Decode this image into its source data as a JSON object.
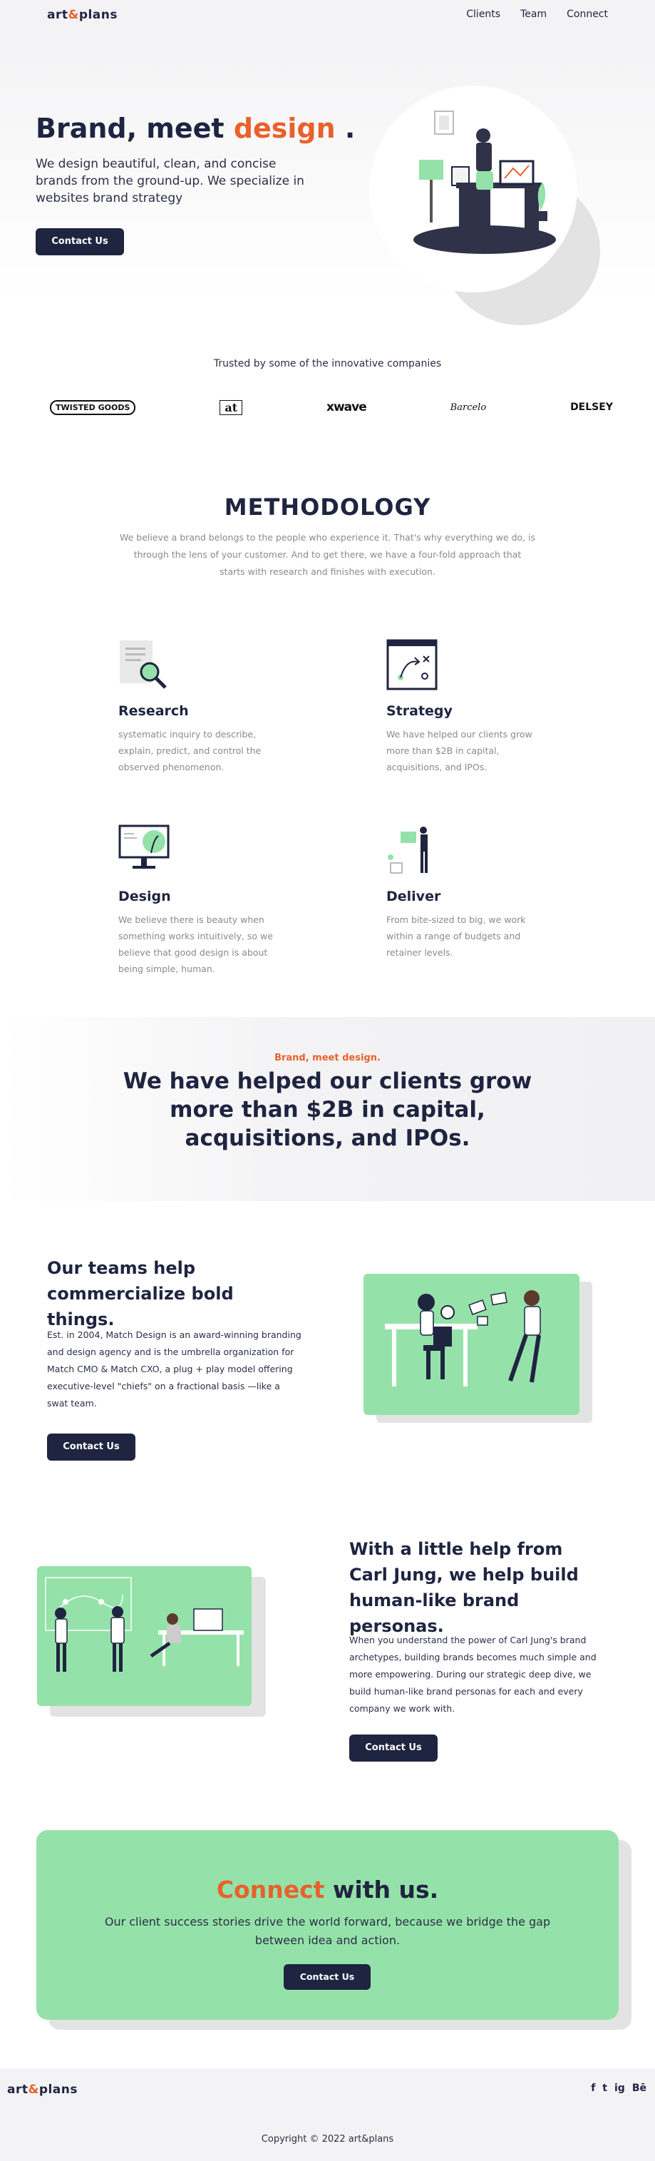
{
  "nav": {
    "logo_pre": "art",
    "logo_amp": "&",
    "logo_post": "plans",
    "links": [
      "Clients",
      "Team",
      "Connect"
    ]
  },
  "hero": {
    "title_pre": "Brand, meet ",
    "title_accent": "design",
    "title_post": " .",
    "subtitle": "We design beautiful, clean, and concise brands from the ground-up. We specialize in websites brand strategy",
    "cta": "Contact Us"
  },
  "trusted": {
    "label": "Trusted by some of the innovative companies",
    "logos": [
      "TWISTED GOODS",
      "at",
      "xwave",
      "Barcelo",
      "DELSEY"
    ]
  },
  "methodology": {
    "title": "METHODOLOGY",
    "description": "We believe a brand belongs to the people who experience it. That's why everything we do, is through the lens of your customer. And to get there, we have a four-fold approach that starts with research and finishes with execution.",
    "cards": [
      {
        "title": "Research",
        "text": "systematic inquiry to describe, explain, predict, and control the observed phenomenon.",
        "icon": "research-magnifier-icon"
      },
      {
        "title": "Strategy",
        "text": "We have helped our clients grow more than $2B in capital, acquisitions, and IPOs.",
        "icon": "strategy-board-icon"
      },
      {
        "title": "Design",
        "text": "We believe there is beauty when something works intuitively, so we believe that good design is about being simple, human.",
        "icon": "design-monitor-icon"
      },
      {
        "title": "Deliver",
        "text": "From bite-sized to big, we work within a range of budgets and retainer levels.",
        "icon": "deliver-boxes-icon"
      }
    ]
  },
  "banner": {
    "tag": "Brand, meet design.",
    "title": "We have helped our clients grow more than $2B in capital, acquisitions, and IPOs."
  },
  "section_teams": {
    "title": "Our teams help commercialize bold things.",
    "body": "Est. in 2004, Match Design is an award-winning branding and design agency and is the umbrella organization for Match CMO & Match CXO, a plug + play model offering executive-level \"chiefs\" on a fractional basis —like a swat team.",
    "cta": "Contact Us"
  },
  "section_jung": {
    "title": "With a little help from Carl Jung, we help build human-like brand personas.",
    "body": "When you understand the power of Carl Jung's brand archetypes, building brands becomes much simple and more empowering. During our strategic deep dive, we build human-like brand personas for each and every company we work with.",
    "cta": "Contact Us"
  },
  "cta_section": {
    "title_accent": "Connect",
    "title_post": " with us.",
    "subtitle": "Our client success stories drive the world forward, because we bridge the gap between idea and action.",
    "cta": "Contact Us"
  },
  "footer": {
    "logo_pre": "art",
    "logo_amp": "&",
    "logo_post": "plans",
    "social": [
      "f",
      "t",
      "ig",
      "Bē"
    ],
    "copyright": "Copyright © 2022 art&plans"
  },
  "colors": {
    "navy": "#1f2440",
    "accent": "#e8612c",
    "green": "#94e2a9",
    "muted": "#8a8a8a"
  }
}
